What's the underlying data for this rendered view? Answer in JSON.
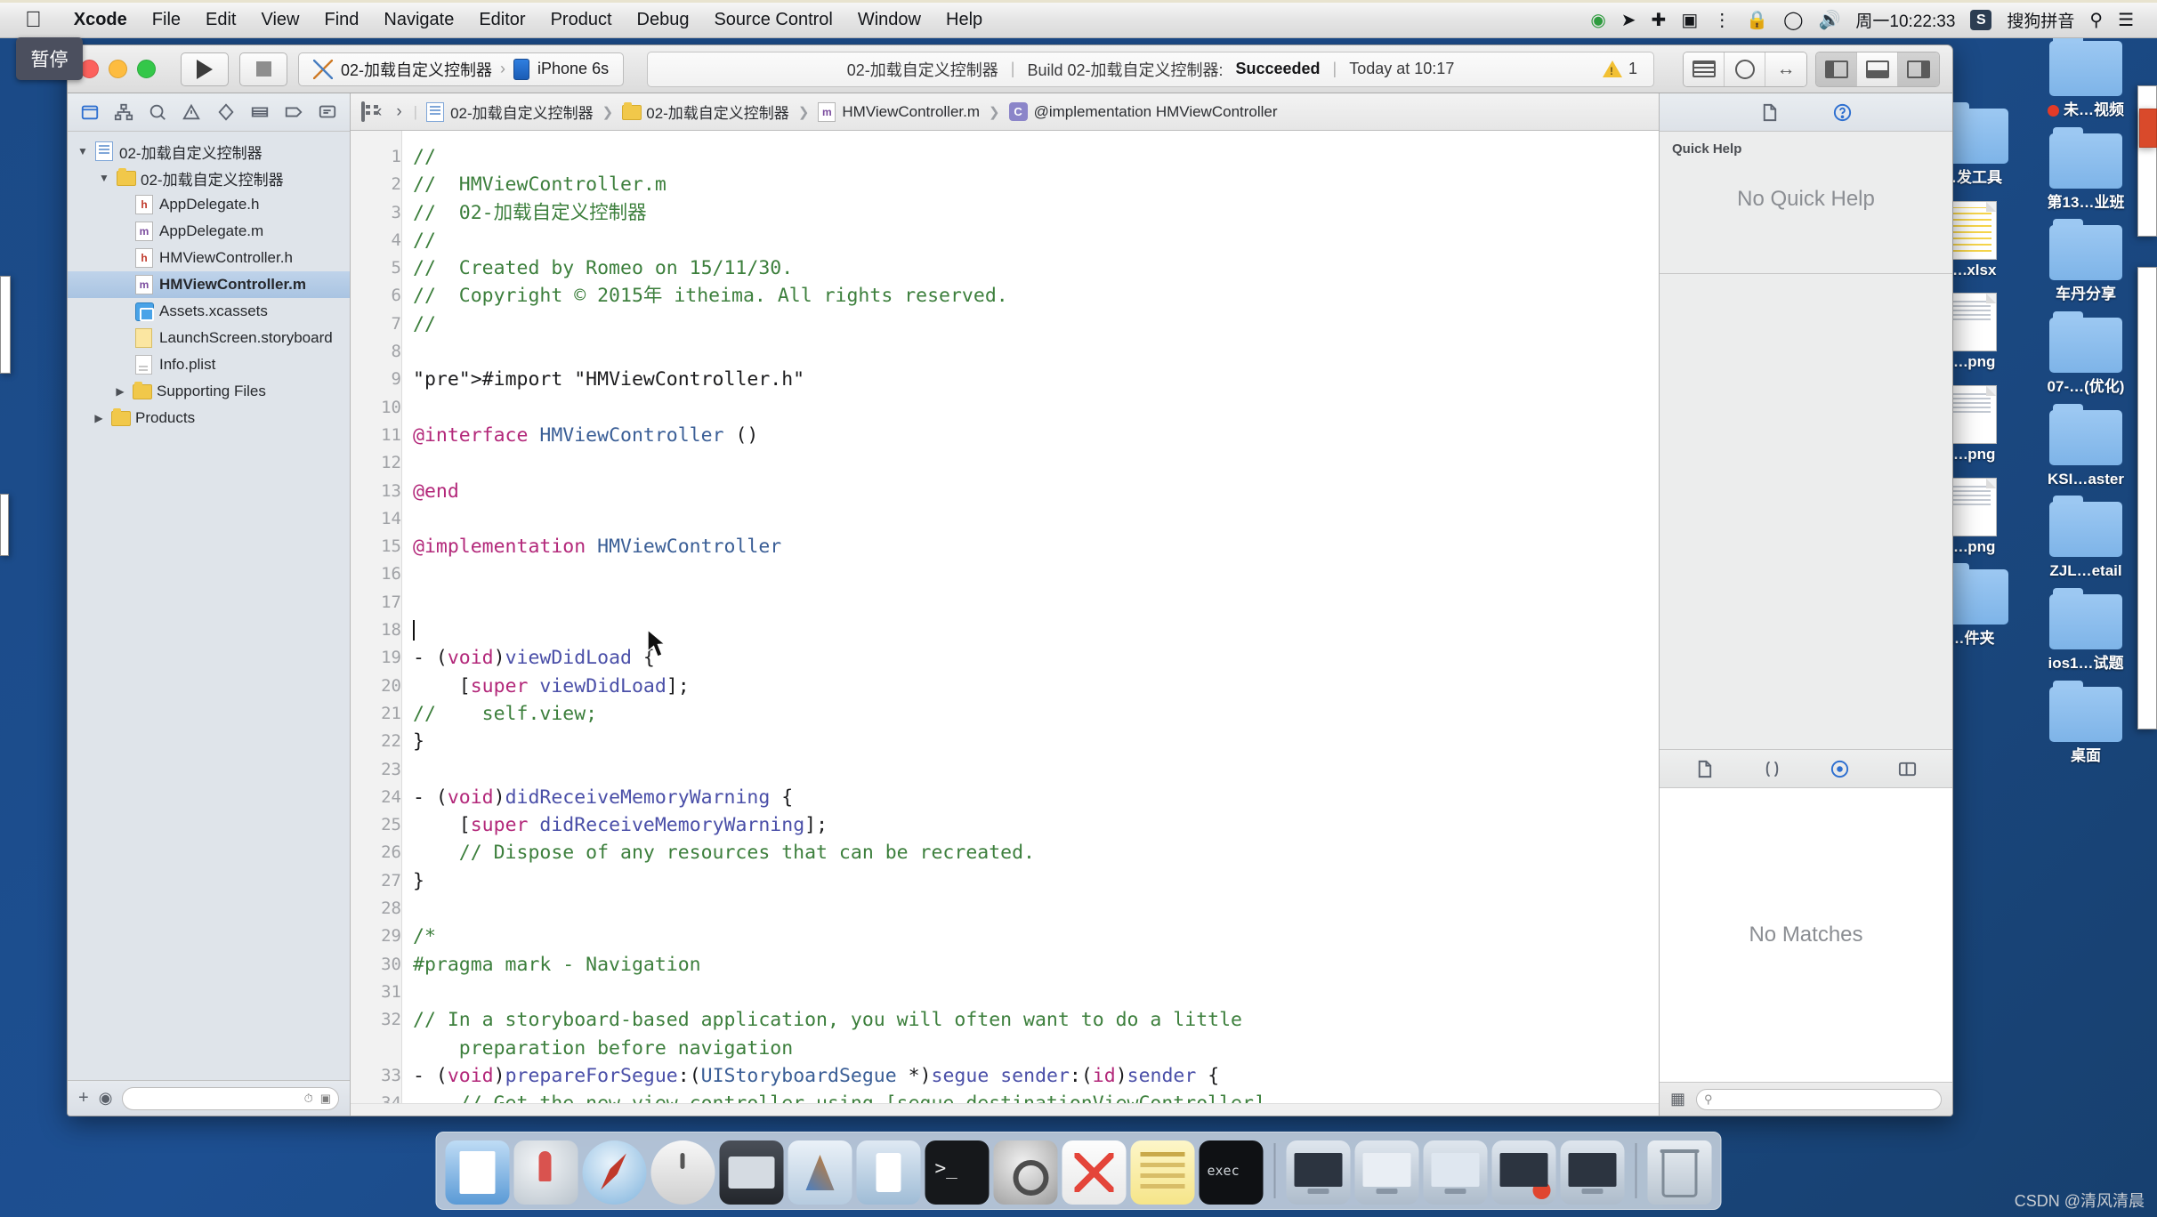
{
  "menubar": {
    "apple_glyph": "@",
    "items": [
      "Xcode",
      "File",
      "Edit",
      "View",
      "Find",
      "Navigate",
      "Editor",
      "Product",
      "Debug",
      "Source Control",
      "Window",
      "Help"
    ],
    "right": {
      "clock": "周一10:22:33",
      "ime_badge": "S",
      "ime_label": "搜狗拼音",
      "icons": [
        "download-icon",
        "location-icon",
        "bluetooth-icon",
        "screen-record-icon",
        "vpn-icon",
        "lock-icon",
        "dropbox-icon",
        "volume-icon",
        "spotlight-search-icon",
        "notification-center-icon"
      ]
    }
  },
  "pause_badge": {
    "label": "暂停"
  },
  "toolbar": {
    "run_tooltip": "Run",
    "stop_tooltip": "Stop",
    "scheme": "02-加载自定义控制器",
    "destination": "iPhone 6s",
    "status_project": "02-加载自定义控制器",
    "status_action": "Build 02-加载自定义控制器: ",
    "status_result": "Succeeded",
    "status_time": "Today at 10:17",
    "warning_count": "1"
  },
  "navigator": {
    "tabs": [
      "project-navigator-tab",
      "symbol-navigator-tab",
      "find-navigator-tab",
      "issue-navigator-tab",
      "test-navigator-tab",
      "debug-navigator-tab",
      "breakpoint-navigator-tab",
      "report-navigator-tab"
    ],
    "tree": [
      {
        "label": "02-加载自定义控制器",
        "icon": "project-icon",
        "depth": 0,
        "twisty": "▼",
        "selected": false
      },
      {
        "label": "02-加载自定义控制器",
        "icon": "folder-icon",
        "depth": 1,
        "twisty": "▼",
        "selected": false
      },
      {
        "label": "AppDelegate.h",
        "icon": "header-file-icon",
        "depth": 2,
        "twisty": "",
        "selected": false
      },
      {
        "label": "AppDelegate.m",
        "icon": "source-file-icon",
        "depth": 2,
        "twisty": "",
        "selected": false
      },
      {
        "label": "HMViewController.h",
        "icon": "header-file-icon",
        "depth": 2,
        "twisty": "",
        "selected": false
      },
      {
        "label": "HMViewController.m",
        "icon": "source-file-icon",
        "depth": 2,
        "twisty": "",
        "selected": true
      },
      {
        "label": "Assets.xcassets",
        "icon": "assets-catalog-icon",
        "depth": 2,
        "twisty": "",
        "selected": false
      },
      {
        "label": "LaunchScreen.storyboard",
        "icon": "storyboard-icon",
        "depth": 2,
        "twisty": "",
        "selected": false
      },
      {
        "label": "Info.plist",
        "icon": "plist-icon",
        "depth": 2,
        "twisty": "",
        "selected": false
      },
      {
        "label": "Supporting Files",
        "icon": "folder-icon",
        "depth": 1,
        "twisty": "▶",
        "selected": false
      },
      {
        "label": "Products",
        "icon": "folder-icon",
        "depth": 0,
        "twisty": "▶",
        "selected": false
      }
    ],
    "footer": {
      "add_label": "+",
      "filter_placeholder": ""
    }
  },
  "jumpbar": {
    "back": "‹",
    "forward": "›",
    "crumbs": [
      {
        "label": "02-加载自定义控制器",
        "icon": "project-icon"
      },
      {
        "label": "02-加载自定义控制器",
        "icon": "folder-icon"
      },
      {
        "label": "HMViewController.m",
        "icon": "source-file-icon"
      },
      {
        "label": "@implementation HMViewController",
        "icon": "category-icon"
      }
    ]
  },
  "editor": {
    "first_line": 1,
    "lines": [
      "//",
      "//  HMViewController.m",
      "//  02-加载自定义控制器",
      "//",
      "//  Created by Romeo on 15/11/30.",
      "//  Copyright © 2015年 itheima. All rights reserved.",
      "//",
      "",
      "#import \"HMViewController.h\"",
      "",
      "@interface HMViewController ()",
      "",
      "@end",
      "",
      "@implementation HMViewController",
      "",
      "",
      "",
      "- (void)viewDidLoad {",
      "    [super viewDidLoad];",
      "//    self.view;",
      "}",
      "",
      "- (void)didReceiveMemoryWarning {",
      "    [super didReceiveMemoryWarning];",
      "    // Dispose of any resources that can be recreated.",
      "}",
      "",
      "/*",
      "#pragma mark - Navigation",
      "",
      "// In a storyboard-based application, you will often want to do a little",
      "- (void)prepareForSegue:(UIStoryboardSegue *)segue sender:(id)sender {",
      "    // Get the new view controller using [segue destinationViewController]."
    ],
    "wrapped_continuation": "preparation before navigation",
    "caret_line": 18
  },
  "utilities": {
    "tabs": [
      "file-inspector-tab",
      "quick-help-inspector-tab"
    ],
    "quick_help": {
      "title": "Quick Help",
      "empty": "No Quick Help"
    },
    "library_tabs": [
      "file-template-library-tab",
      "code-snippet-library-tab",
      "object-library-tab",
      "media-library-tab"
    ],
    "library": {
      "empty": "No Matches",
      "search_placeholder": ""
    }
  },
  "desktop": {
    "column_files": [
      {
        "label": "…发工具",
        "icon": "folder-icon"
      },
      {
        "label": "….xlsx",
        "icon": "xlsx-file-icon"
      },
      {
        "label": "….png",
        "icon": "png-file-icon"
      },
      {
        "label": "….png",
        "icon": "png-file-icon"
      },
      {
        "label": "….png",
        "icon": "png-file-icon"
      },
      {
        "label": "…件夹",
        "icon": "folder-icon"
      }
    ],
    "column_folders": [
      {
        "label": "未…视频",
        "icon": "folder-icon",
        "badge": "red-dot"
      },
      {
        "label": "第13…业班",
        "icon": "folder-icon"
      },
      {
        "label": "车丹分享",
        "icon": "folder-icon"
      },
      {
        "label": "07-…(优化)",
        "icon": "folder-icon"
      },
      {
        "label": "KSI…aster",
        "icon": "folder-icon"
      },
      {
        "label": "ZJL…etail",
        "icon": "folder-icon"
      },
      {
        "label": "ios1…试题",
        "icon": "folder-icon"
      },
      {
        "label": "桌面",
        "icon": "folder-icon"
      }
    ]
  },
  "dock": {
    "items": [
      {
        "name": "finder",
        "cls": "finder"
      },
      {
        "name": "launchpad",
        "cls": "launch"
      },
      {
        "name": "safari",
        "cls": "safari"
      },
      {
        "name": "mouse-utility",
        "cls": "mouse"
      },
      {
        "name": "quicktime",
        "cls": "movie"
      },
      {
        "name": "xcode",
        "cls": "xc1"
      },
      {
        "name": "xcode-beta",
        "cls": "xc2"
      },
      {
        "name": "terminal",
        "cls": "term"
      },
      {
        "name": "system-preferences",
        "cls": "prefs"
      },
      {
        "name": "xmind",
        "cls": "xmind"
      },
      {
        "name": "notes",
        "cls": "notes"
      },
      {
        "name": "executable",
        "cls": "exec"
      }
    ],
    "items2": [
      {
        "name": "screen-1",
        "cls": "screen"
      },
      {
        "name": "screen-2",
        "cls": "screen x"
      },
      {
        "name": "screen-3",
        "cls": "screen x2"
      },
      {
        "name": "screen-4-alert",
        "cls": "screen badge"
      },
      {
        "name": "screen-5",
        "cls": "screen"
      }
    ],
    "trash": {
      "name": "trash",
      "cls": "trash"
    }
  },
  "watermark": {
    "text": "CSDN @清风清晨"
  }
}
